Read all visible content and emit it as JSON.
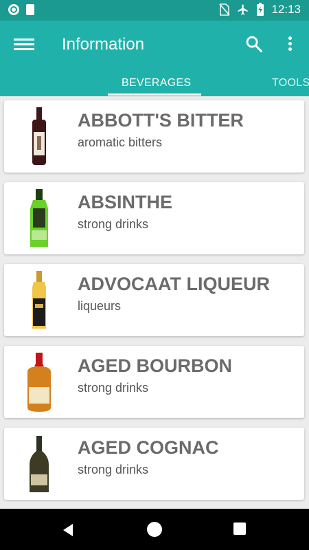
{
  "status": {
    "time": "12:13"
  },
  "appbar": {
    "title": "Information"
  },
  "tabs": [
    {
      "label": "BEVERAGES"
    },
    {
      "label": "TOOLS"
    }
  ],
  "items": [
    {
      "name": "ABBOTT'S BITTER",
      "type": "aromatic bitters"
    },
    {
      "name": "ABSINTHE",
      "type": "strong drinks"
    },
    {
      "name": "ADVOCAAT LIQUEUR",
      "type": "liqueurs"
    },
    {
      "name": "AGED BOURBON",
      "type": "strong drinks"
    },
    {
      "name": "AGED COGNAC",
      "type": "strong drinks"
    }
  ],
  "colors": {
    "primary": "#20b2aa",
    "status_bar": "#1b9a92",
    "name_text": "#6b6b6b"
  }
}
